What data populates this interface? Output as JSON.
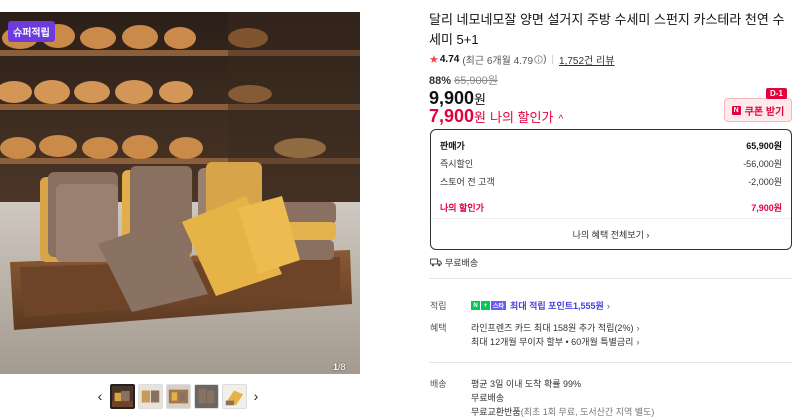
{
  "gallery": {
    "badge": "슈퍼적립",
    "counter_current": "1",
    "counter_total": "/8",
    "thumbs_prev": "‹",
    "thumbs_next": "›",
    "thumbnail_count": 5,
    "active_thumbnail": 1
  },
  "product": {
    "title": "달리 네모네모잘 양면 설거지 주방 수세미 스펀지 카스테라 천연 수세미 5+1",
    "rating": "4.74",
    "rating_recent": "(최근 6개월 4.79",
    "rating_recent_close": ")",
    "reviews": "1,752건 리뷰",
    "discount_pct": "88%",
    "original_price": "65,900원",
    "price": "9,900",
    "price_unit": "원",
    "my_price": "7,900",
    "my_price_unit": "원",
    "my_price_label": "나의 할인가",
    "my_price_toggle": "^"
  },
  "coupon": {
    "dday": "D-1",
    "icon": "N",
    "label": "쿠폰 받기"
  },
  "price_box": {
    "rows": [
      {
        "label": "판매가",
        "value": "65,900원"
      },
      {
        "label": "즉시할인",
        "value": "-56,000원"
      },
      {
        "label": "스토어 전 고객",
        "value": "-2,000원"
      },
      {
        "label": "나의 할인가",
        "value": "7,900원"
      }
    ],
    "more": "나의 혜택 전체보기 ›"
  },
  "shipping": {
    "label": "무료배송"
  },
  "benefits": {
    "points_label": "적립",
    "points_badge_n": "N",
    "points_badge_plus": "+",
    "points_badge_s": "스타",
    "points_text": "최대 적립 포인트 ",
    "points_value": "1,555원",
    "points_chev": "›",
    "benefit_label": "혜택",
    "benefit_line1": "라인프렌즈 카드 최대 158원 추가 적립(2%)",
    "benefit_line1_chev": "›",
    "benefit_line2": "최대 12개월 무이자 할부 • 60개월 특별금리",
    "benefit_line2_chev": "›",
    "delivery_label": "배송",
    "delivery_line1": "평균 3일 이내 도착 확률 99%",
    "delivery_line2": "무료배송",
    "delivery_line3": "무료교환반품",
    "delivery_line3_note": " (최초 1회 무료, 도서산간 지역 별도)"
  },
  "colors": {
    "accent_red": "#e5003e",
    "badge_purple": "#6b3bdc",
    "point_purple": "#4a3ee0",
    "naver_green": "#03c75a"
  }
}
